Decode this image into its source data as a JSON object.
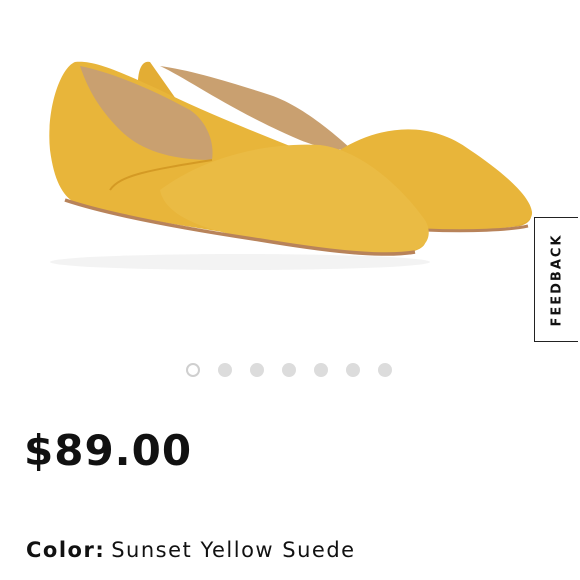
{
  "product": {
    "image_alt": "Yellow suede pointed-toe d'Orsay flats",
    "colors": {
      "suede": "#e8b53a",
      "suede_shadow": "#d49a24",
      "lining": "#c9a070",
      "sole": "#b8835a"
    },
    "price": "$89.00",
    "color_label": "Color:",
    "color_value": "Sunset Yellow Suede"
  },
  "gallery": {
    "dot_count": 7,
    "active_index": 0
  },
  "feedback": {
    "label": "FEEDBACK"
  }
}
